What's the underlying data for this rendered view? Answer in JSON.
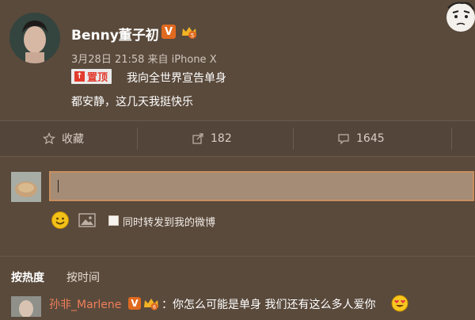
{
  "post": {
    "author": "Benny董子初",
    "verified_badge": "V",
    "meta": "3月28日 21:58 来自 iPhone X",
    "pin_label": "置顶",
    "pin_icon_glyph": "↑",
    "lines": [
      "我向全世界宣告单身",
      "都安静，这几天我挺快乐"
    ]
  },
  "actions": {
    "favorite_label": "收藏",
    "repost_count": "182",
    "comment_count": "1645"
  },
  "compose": {
    "input_value": "",
    "sync_label": "同时转发到我的微博"
  },
  "sort": {
    "hot_label": "按热度",
    "time_label": "按时间"
  },
  "comment": {
    "author": "孙非_Marlene",
    "verified_badge": "V",
    "text": "：你怎么可能是单身 我们还有这么多人爱你"
  },
  "colors": {
    "background": "#5a4a3c",
    "accent_orange": "#e06a1f",
    "pin_red": "#e23b2e",
    "input_border": "#c88f60",
    "commenter_name": "#f07f5a"
  },
  "icons": {
    "favorite": "star-icon",
    "repost": "share-icon",
    "comment": "comment-icon",
    "emoji": "smiley-icon",
    "image": "image-icon"
  }
}
